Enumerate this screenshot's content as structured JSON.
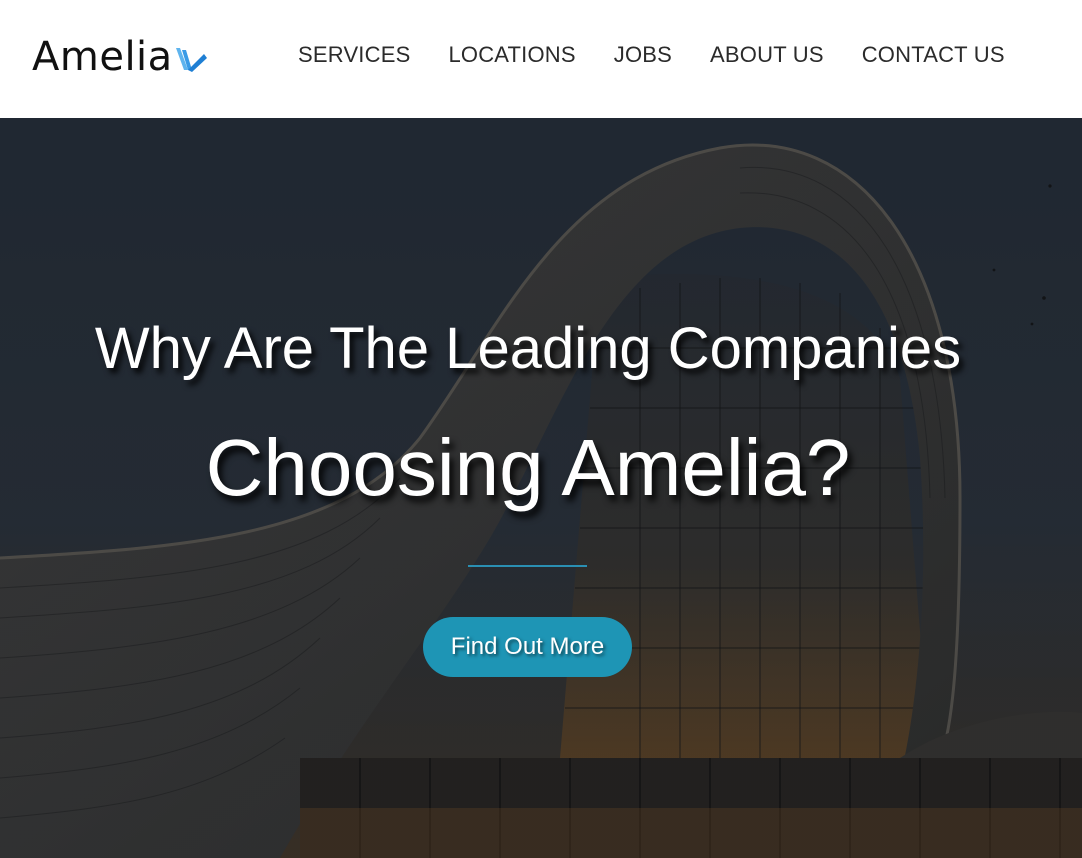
{
  "brand": {
    "name": "Amelia",
    "logo_icon": "wing-chevron-logo-icon",
    "accent_color": "#1f8fd6"
  },
  "nav": {
    "items": [
      {
        "label": "SERVICES"
      },
      {
        "label": "LOCATIONS"
      },
      {
        "label": "JOBS"
      },
      {
        "label": "ABOUT US"
      },
      {
        "label": "CONTACT US"
      }
    ]
  },
  "hero": {
    "headline_line1": "Why Are The Leading Companies",
    "headline_line2": "Choosing Amelia?",
    "cta_label": "Find Out More",
    "cta_color": "#1e95b5",
    "divider_color": "#2a8fb3"
  }
}
